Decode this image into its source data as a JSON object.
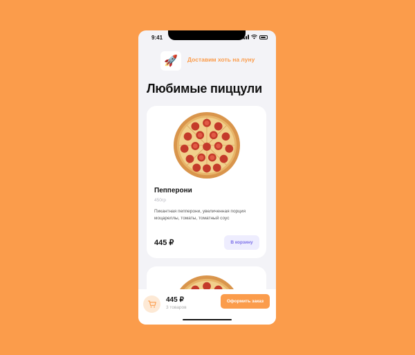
{
  "status_bar": {
    "time": "9:41"
  },
  "header": {
    "logo_emoji": "🚀",
    "tagline": "Доставим хоть на луну"
  },
  "page": {
    "title": "Любимые пиццули"
  },
  "products": [
    {
      "name": "Пепперони",
      "weight": "450гр",
      "description": "Пикантная пепперони, увеличенная порция моцареллы, томаты, томатный соус",
      "price": "445 ₽",
      "add_label": "В корзину"
    }
  ],
  "cart": {
    "total": "445 ₽",
    "count_label": "3 товаров",
    "order_label": "Оформить заказ"
  },
  "colors": {
    "background": "#FB9C4B",
    "accent": "#FB9C4B",
    "add_button_text": "#7B6FE8"
  }
}
